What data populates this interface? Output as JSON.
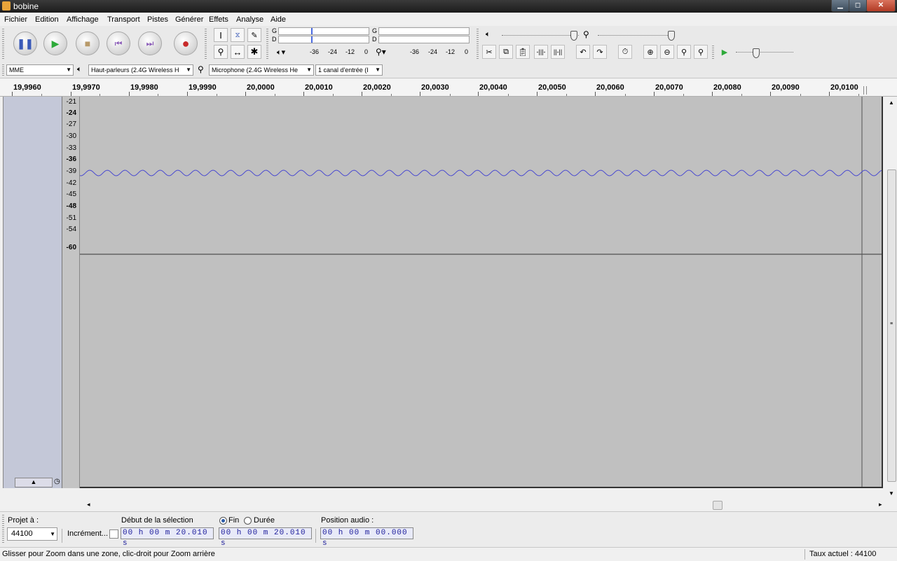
{
  "window": {
    "title": "bobine"
  },
  "menu": [
    "Fichier",
    "Edition",
    "Affichage",
    "Transport",
    "Pistes",
    "Générer",
    "Effets",
    "Analyse",
    "Aide"
  ],
  "meters": {
    "play_channels": [
      "G",
      "D"
    ],
    "rec_channels": [
      "G",
      "D"
    ],
    "play_scale": [
      "-36",
      "-24",
      "-12",
      "0"
    ],
    "rec_scale": [
      "-36",
      "-24",
      "-12",
      "0"
    ]
  },
  "device": {
    "host": "MME",
    "output": "Haut-parleurs (2.4G Wireless H",
    "input": "Microphone (2.4G Wireless He",
    "channels": "1 canal d'entrée (I"
  },
  "ruler": [
    "19,9960",
    "19,9970",
    "19,9980",
    "19,9990",
    "20,0000",
    "20,0010",
    "20,0020",
    "20,0030",
    "20,0040",
    "20,0050",
    "20,0060",
    "20,0070",
    "20,0080",
    "20,0090",
    "20,0100"
  ],
  "db_scale": [
    "-21",
    "-24",
    "-27",
    "-30",
    "-33",
    "-36",
    "-39",
    "-42",
    "-45",
    "-48",
    "-51",
    "-54",
    "-60"
  ],
  "selection": {
    "project_rate_label": "Projet à :",
    "project_rate": "44100",
    "snap_label": "Incrément...",
    "start_label": "Début de la sélection",
    "end_label": "Fin",
    "length_label": "Durée",
    "audio_pos_label": "Position audio :",
    "start_time": "00 h 00 m 20.010 s",
    "end_time": "00 h 00 m 20.010 s",
    "audio_time": "00 h 00 m 00.000 s"
  },
  "status": {
    "hint": "Glisser pour Zoom dans une zone, clic-droit pour Zoom arrière",
    "rate": "Taux actuel : 44100"
  },
  "colors": {
    "waveform": "#4a4ad0",
    "track_bg": "#c0c0c0",
    "clock_text": "#1a1a9a"
  }
}
